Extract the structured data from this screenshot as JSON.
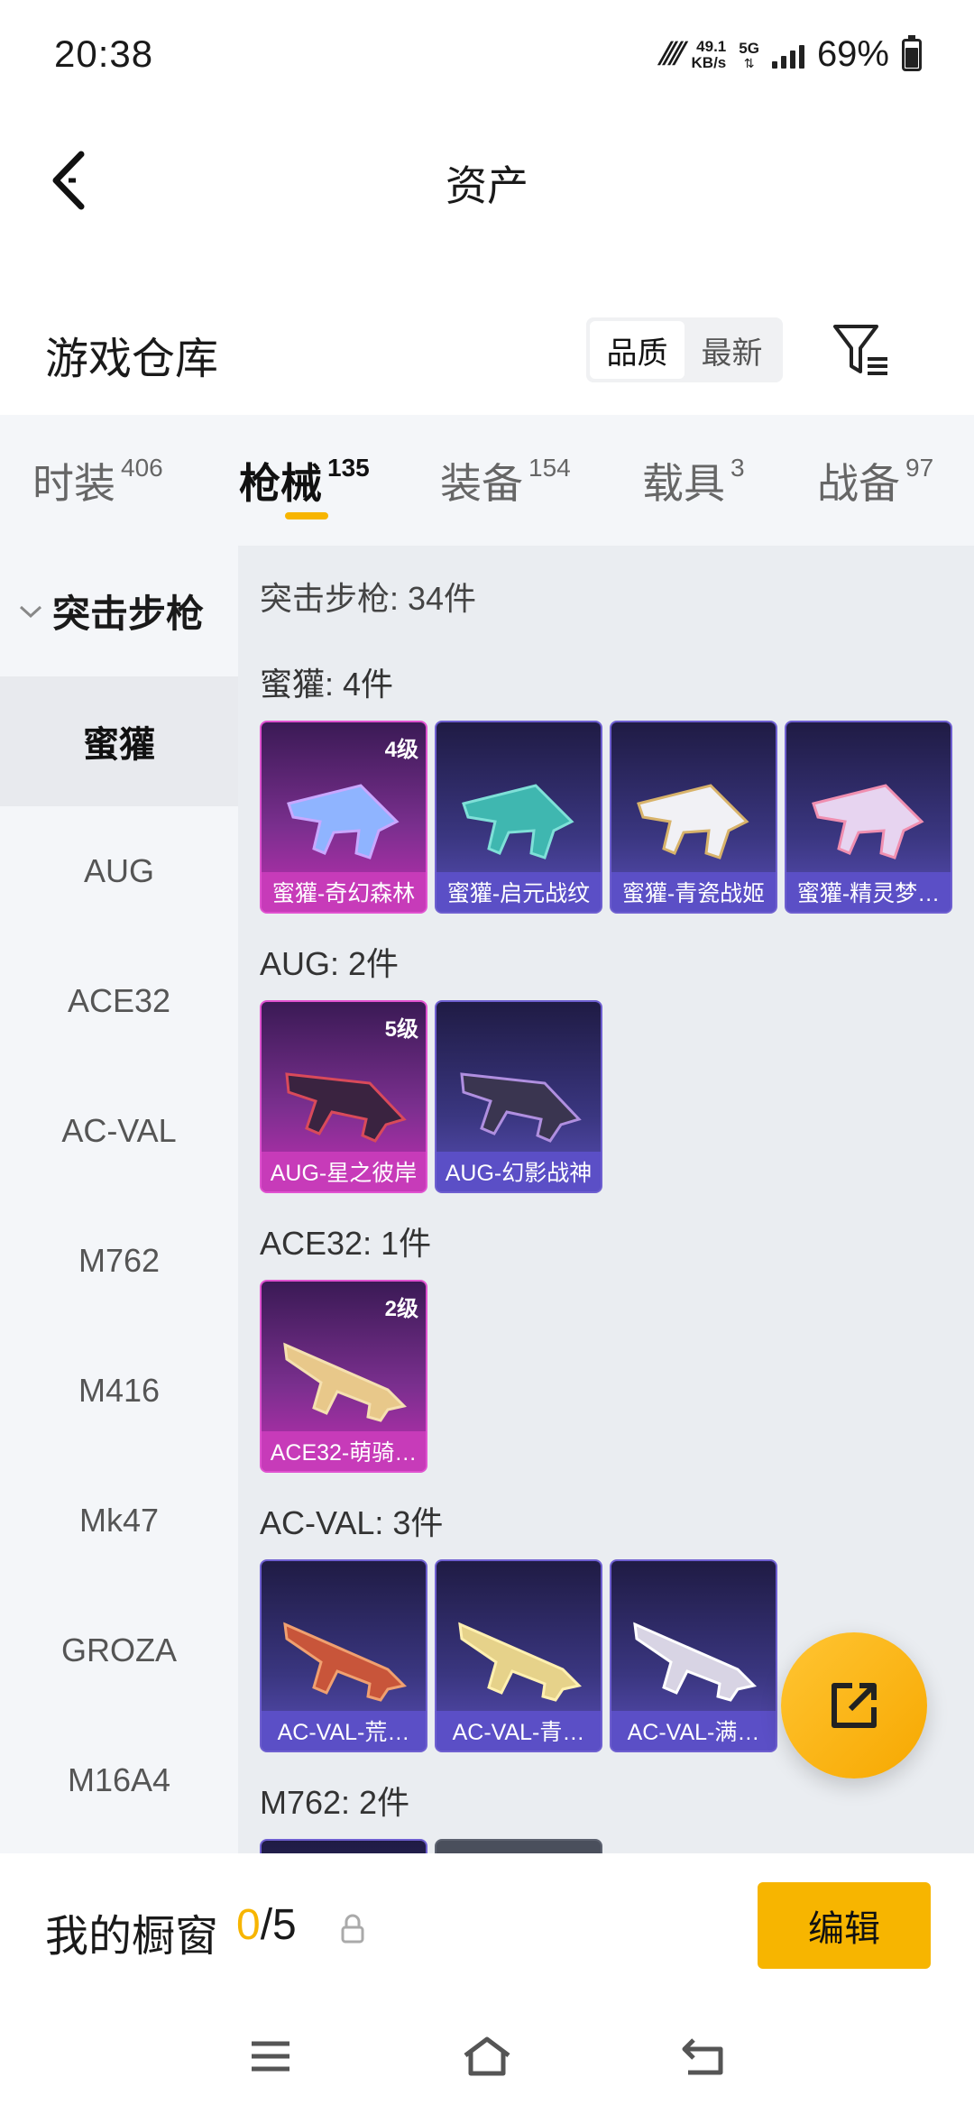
{
  "status_bar": {
    "time": "20:38",
    "speed_value": "49.1",
    "speed_unit": "KB/s",
    "network": "5G",
    "battery": "69%"
  },
  "header": {
    "title": "资产"
  },
  "warehouse": {
    "title": "游戏仓库",
    "sort_options": [
      "品质",
      "最新"
    ],
    "sort_selected": "品质"
  },
  "tabs": [
    {
      "label": "时装",
      "count": "406"
    },
    {
      "label": "枪械",
      "count": "135",
      "active": true
    },
    {
      "label": "装备",
      "count": "154"
    },
    {
      "label": "载具",
      "count": "3"
    },
    {
      "label": "战备",
      "count": "97"
    }
  ],
  "sidebar": {
    "group": "突击步枪",
    "items": [
      "蜜獾",
      "AUG",
      "ACE32",
      "AC-VAL",
      "M762",
      "M416",
      "Mk47",
      "GROZA",
      "M16A4"
    ],
    "active": "蜜獾"
  },
  "content": {
    "total": "突击步枪: 34件",
    "sections": [
      {
        "label": "蜜獾: 4件",
        "items": [
          {
            "name": "蜜獾-奇幻森林",
            "level": "4级",
            "rarity": "pink"
          },
          {
            "name": "蜜獾-启元战纹",
            "level": "",
            "rarity": "blue"
          },
          {
            "name": "蜜獾-青瓷战姬",
            "level": "",
            "rarity": "blue"
          },
          {
            "name": "蜜獾-精灵梦…",
            "level": "",
            "rarity": "blue"
          }
        ]
      },
      {
        "label": "AUG: 2件",
        "items": [
          {
            "name": "AUG-星之彼岸",
            "level": "5级",
            "rarity": "pink"
          },
          {
            "name": "AUG-幻影战神",
            "level": "",
            "rarity": "blue"
          }
        ]
      },
      {
        "label": "ACE32: 1件",
        "items": [
          {
            "name": "ACE32-萌骑…",
            "level": "2级",
            "rarity": "pink"
          }
        ]
      },
      {
        "label": "AC-VAL: 3件",
        "items": [
          {
            "name": "AC-VAL-荒…",
            "level": "",
            "rarity": "blue"
          },
          {
            "name": "AC-VAL-青…",
            "level": "",
            "rarity": "blue"
          },
          {
            "name": "AC-VAL-满…",
            "level": "",
            "rarity": "blue"
          }
        ]
      },
      {
        "label": "M762: 2件",
        "items": [
          {
            "name": "",
            "level": "",
            "rarity": "blue"
          },
          {
            "name": "",
            "level": "",
            "rarity": "grey"
          }
        ]
      }
    ]
  },
  "showcase": {
    "title": "我的橱窗",
    "current": "0",
    "max": "/5",
    "edit_label": "编辑"
  },
  "colors": {
    "accent": "#f7b500",
    "pink_rarity": "#c73bb9",
    "blue_rarity": "#5b4fc6"
  },
  "icons": {
    "back": "back-arrow-icon",
    "filter": "filter-icon",
    "fab": "share-external-icon",
    "lock": "lock-icon",
    "nav": [
      "menu-icon",
      "home-icon",
      "back-icon"
    ]
  }
}
